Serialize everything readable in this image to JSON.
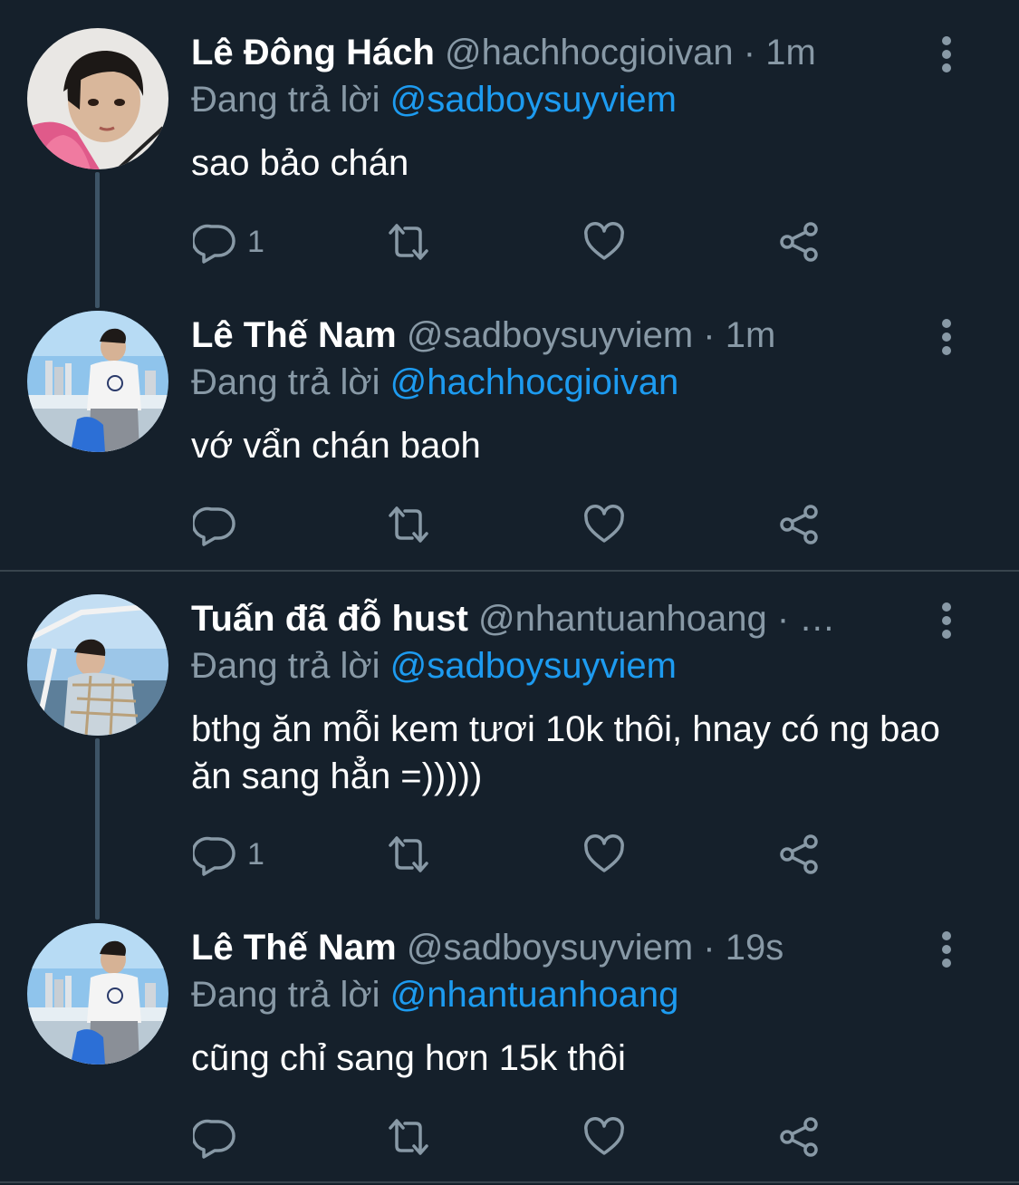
{
  "tweets": [
    {
      "name": "Lê Đông Hách",
      "handle": "@hachhocgioivan",
      "dot": "·",
      "time": "1m",
      "replying_prefix": "Đang trả lời",
      "replying_to": "@sadboysuyviem",
      "text": "sao bảo chán",
      "reply_count": "1"
    },
    {
      "name": "Lê Thế Nam",
      "handle": "@sadboysuyviem",
      "dot": "·",
      "time": "1m",
      "replying_prefix": "Đang trả lời",
      "replying_to": "@hachhocgioivan",
      "text": "vớ vẩn chán baoh",
      "reply_count": ""
    },
    {
      "name": "Tuấn đã đỗ hust",
      "handle": "@nhantuanhoang",
      "dot": "·",
      "time": "…",
      "replying_prefix": "Đang trả lời",
      "replying_to": "@sadboysuyviem",
      "text": "bthg ăn mỗi kem tươi 10k thôi, hnay có ng bao ăn sang hẳn =)))))",
      "reply_count": "1"
    },
    {
      "name": "Lê Thế Nam",
      "handle": "@sadboysuyviem",
      "dot": "·",
      "time": "19s",
      "replying_prefix": "Đang trả lời",
      "replying_to": "@nhantuanhoang",
      "text": "cũng chỉ sang hơn 15k thôi",
      "reply_count": ""
    }
  ],
  "icons": {
    "reply": "reply-icon",
    "retweet": "retweet-icon",
    "like": "heart-icon",
    "share": "share-icon",
    "more": "more-vertical-icon"
  },
  "colors": {
    "background": "#15202b",
    "secondary_text": "#8899a6",
    "mention": "#1d9bf0",
    "divider": "#38444d"
  }
}
